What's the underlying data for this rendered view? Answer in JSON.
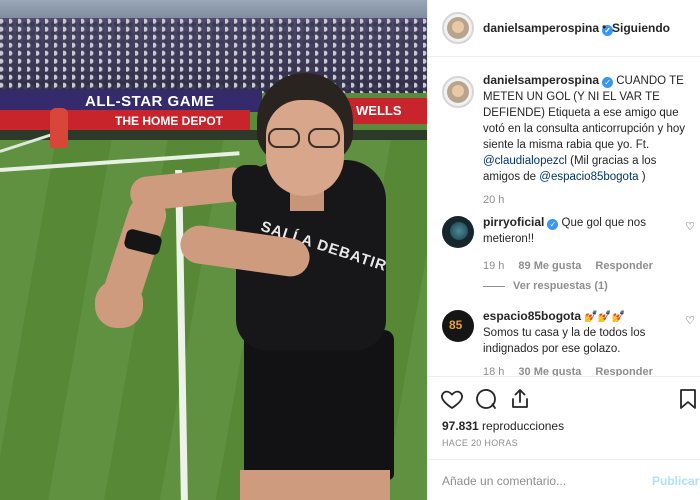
{
  "media": {
    "board_left": "ALL-STAR GAME",
    "board_red": "THE HOME DEPOT",
    "board_right": "WELLS",
    "shirt_text": "SALÍ A DEBATIR"
  },
  "header": {
    "username": "danielsamperospina",
    "separator": "•",
    "follow_status": "Siguiendo"
  },
  "caption": {
    "username": "danielsamperospina",
    "text_main": " CUANDO TE METEN UN GOL (Y NI EL VAR TE DEFIENDE) Etiqueta a ese amigo que votó en la consulta anticorrupción y hoy siente la misma rabia que yo. Ft. ",
    "mention1": "@claudialopezcl",
    "text_mid": " (Mil gracias a los amigos de ",
    "mention2": "@espacio85bogota",
    "text_end": " )",
    "time": "20 h"
  },
  "comments": [
    {
      "username": "pirryoficial",
      "text": " Que gol que nos metieron!!",
      "time": "19 h",
      "likes": "89 Me gusta",
      "reply": "Responder",
      "view_replies": "Ver respuestas (1)"
    },
    {
      "username": "espacio85bogota",
      "emoji": " 💅💅💅",
      "text": "Somos tu casa y la de todos los indignados por ese golazo.",
      "time": "18 h",
      "likes": "30 Me gusta",
      "reply": "Responder"
    }
  ],
  "actions": {
    "icons": [
      "heart-icon",
      "comment-icon",
      "share-icon",
      "bookmark-icon"
    ],
    "views_count": "97.831",
    "views_label": " reproducciones",
    "posted": "HACE 20 HORAS"
  },
  "comment_box": {
    "placeholder": "Añade un comentario...",
    "publish": "Publicar"
  },
  "colors": {
    "link": "#003569",
    "verified": "#3897f0",
    "publish_disabled": "#b2dffc",
    "muted": "#8e8e8e"
  }
}
